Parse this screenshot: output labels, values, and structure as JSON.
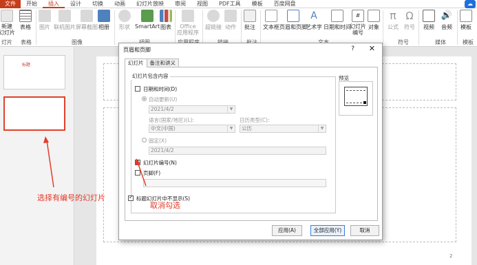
{
  "ribbon_tabs": [
    "文件",
    "开始",
    "插入",
    "设计",
    "切换",
    "动画",
    "幻灯片放映",
    "审阅",
    "视图",
    "PDF工具",
    "模板",
    "百度网盘"
  ],
  "ribbon_buttons": {
    "new_slide": "新建\n幻灯片",
    "table": "表格",
    "image": "图片",
    "online_image": "联机图片",
    "screenshot": "屏幕截图",
    "album": "相册",
    "shape": "形状",
    "smartart": "SmartArt",
    "chart": "图表",
    "office_apps": "Office\n应用程序",
    "hyperlink": "超链接",
    "action": "动作",
    "comment": "批注",
    "textbox": "文本框",
    "header_footer": "页眉和页脚",
    "wordart": "艺术字",
    "datetime": "日期和时间",
    "slide_number": "幻灯片\n编号",
    "object": "对象",
    "equation": "公式",
    "symbol": "符号",
    "video": "视频",
    "audio": "音频",
    "template": "模板"
  },
  "ribbon_groups": {
    "slides": "灯片",
    "tables": "表格",
    "images": "图像",
    "illustrations": "插图",
    "apps": "应用程序",
    "links": "链接",
    "comments": "批注",
    "text": "文本",
    "symbols": "符号",
    "media": "媒体",
    "template": "模板"
  },
  "thumb1_title": "标题",
  "page_number": "2",
  "dialog": {
    "title": "页眉和页脚",
    "help": "?",
    "close": "✕",
    "tabs": [
      "幻灯片",
      "备注和讲义"
    ],
    "group_label": "幻灯片包含内容",
    "date_time_label": "日期和时间(D)",
    "auto_update_label": "自动更新(U)",
    "auto_date_value": "2021/4/2",
    "language_label": "语言(国家/地区)(L):",
    "calendar_label": "日历类型(C):",
    "language_value": "中文(中国)",
    "calendar_value": "公历",
    "fixed_label": "固定(X)",
    "fixed_value": "2021/4/2",
    "slide_number_label": "幻灯片编号(N)",
    "slide_number_checked": true,
    "footer_label": "页脚(F)",
    "footer_value": "",
    "hide_title_label": "标题幻灯片中不显示(S)",
    "hide_title_checked": true,
    "preview_label": "预览",
    "apply_btn": "应用(A)",
    "apply_all_btn": "全部应用(Y)",
    "cancel_btn": "取消"
  },
  "annotations": {
    "select_slide": "选择有编号的幻灯片",
    "uncheck": "取消勾选"
  },
  "colors": {
    "accent": "#c43e1c",
    "annotation": "#e53a2a"
  }
}
